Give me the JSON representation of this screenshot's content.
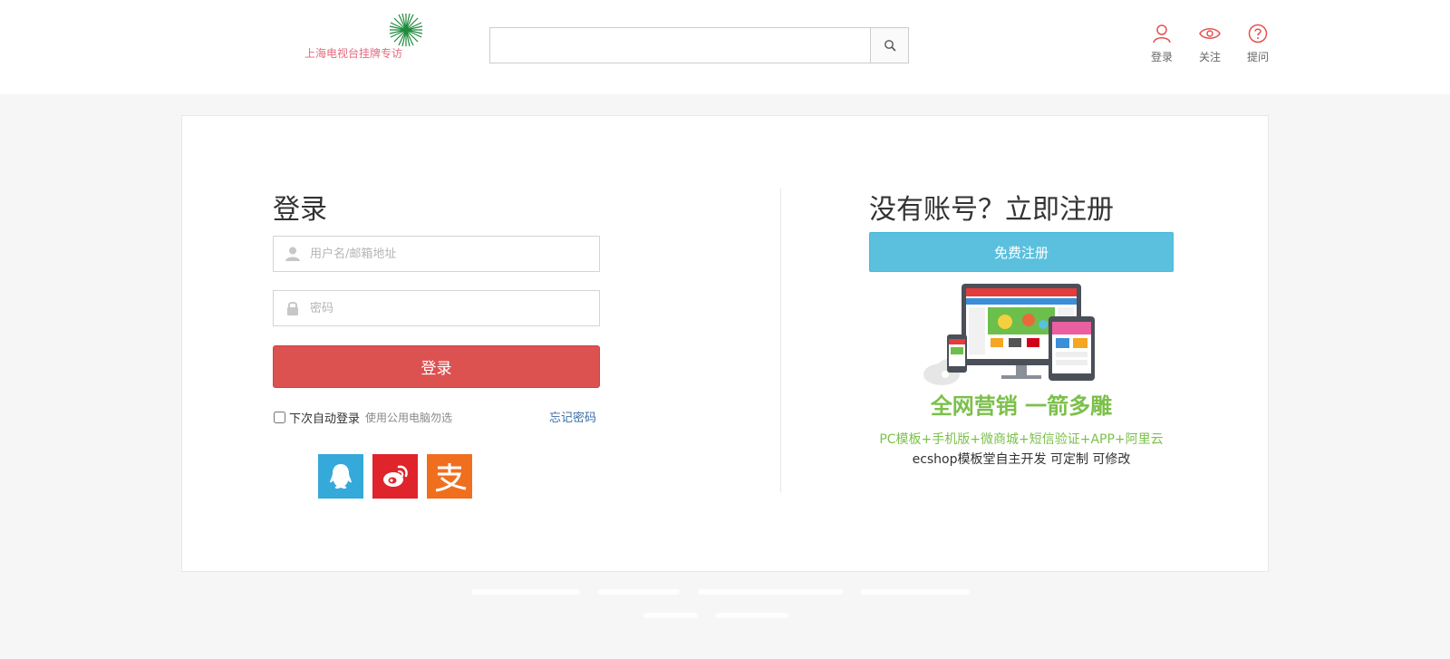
{
  "header": {
    "logo_text": "上海电视台挂牌专访",
    "search": {
      "placeholder": "",
      "value": ""
    },
    "top_links": [
      {
        "label": "登录",
        "icon": "user-icon"
      },
      {
        "label": "关注",
        "icon": "eye-icon"
      },
      {
        "label": "提问",
        "icon": "question-icon"
      }
    ]
  },
  "login": {
    "title": "登录",
    "username_placeholder": "用户名/邮箱地址",
    "password_placeholder": "密码",
    "submit_label": "登录",
    "remember_label": "下次自动登录",
    "remember_hint": "使用公用电脑勿选",
    "forgot_label": "忘记密码",
    "social": [
      "qq-icon",
      "weibo-icon",
      "alipay-icon"
    ]
  },
  "register": {
    "title": "没有账号？立即注册",
    "button_label": "免费注册",
    "slogan": "全网营销  一箭多雕",
    "line1": "PC模板+手机版+微商城+短信验证+APP+阿里云",
    "line2": "ecshop模板堂自主开发 可定制 可修改"
  },
  "colors": {
    "login_button": "#dc5251",
    "register_button": "#5bc0de",
    "promo_green": "#7cc04b",
    "accent_red": "#e4514f",
    "link_blue": "#3a6ea5"
  }
}
